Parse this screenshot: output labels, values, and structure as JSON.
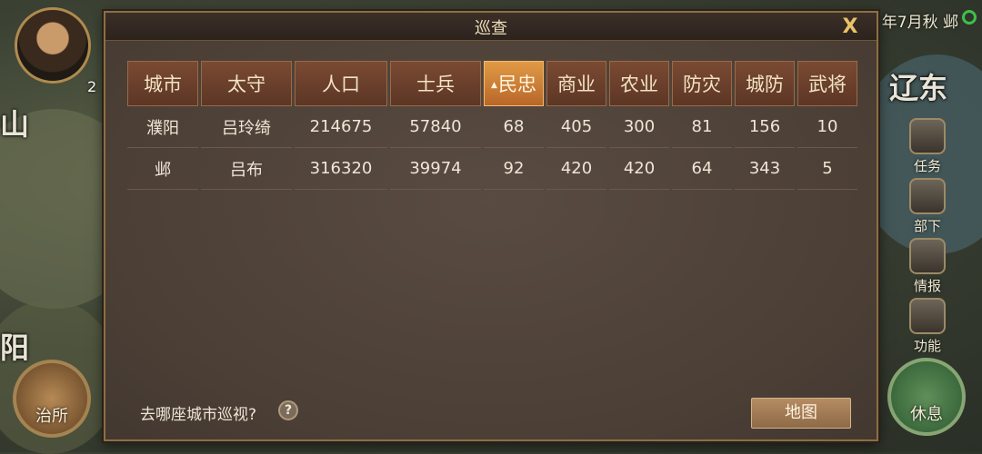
{
  "map": {
    "labels": [
      "山",
      "辽东",
      "阳"
    ],
    "date": "年7月秋 邺",
    "player_level": "2",
    "side_buttons": [
      "任务",
      "部下",
      "情报",
      "功能"
    ],
    "office_button": "治所",
    "rest_button": "休息"
  },
  "dialog": {
    "title": "巡查",
    "close": "X",
    "prompt": "去哪座城市巡视?",
    "help": "?",
    "map_button": "地图"
  },
  "table": {
    "headers": [
      "城市",
      "太守",
      "人口",
      "士兵",
      "民忠",
      "商业",
      "农业",
      "防灾",
      "城防",
      "武将"
    ],
    "active_header_index": 4,
    "rows": [
      [
        "濮阳",
        "吕玲绮",
        "214675",
        "57840",
        "68",
        "405",
        "300",
        "81",
        "156",
        "10"
      ],
      [
        "邺",
        "吕布",
        "316320",
        "39974",
        "92",
        "420",
        "420",
        "64",
        "343",
        "5"
      ]
    ]
  }
}
